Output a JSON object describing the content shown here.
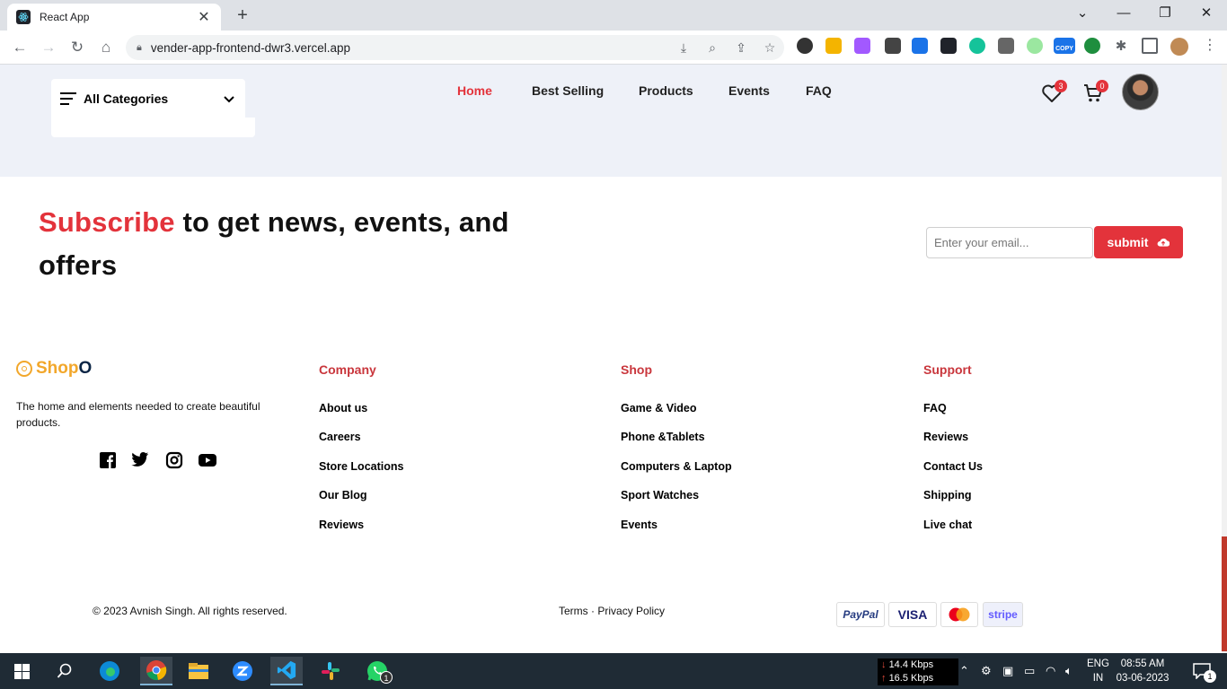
{
  "browser": {
    "tab_title": "React App",
    "url": "vender-app-frontend-dwr3.vercel.app",
    "extension_badge_copy": "COPY"
  },
  "header": {
    "categories_label": "All Categories",
    "nav": [
      "Home",
      "Best Selling",
      "Products",
      "Events",
      "FAQ"
    ],
    "wishlist_count": "3",
    "cart_count": "0"
  },
  "subscribe": {
    "highlight": "Subscribe",
    "rest": " to get news, events, and offers",
    "placeholder": "Enter your email...",
    "submit_label": "submit"
  },
  "footer": {
    "logo_part1": "Shop",
    "logo_part2": "O",
    "tagline": "The home and elements needed to create beautiful products.",
    "columns": [
      {
        "title": "Company",
        "links": [
          "About us",
          "Careers",
          "Store Locations",
          "Our Blog",
          "Reviews"
        ]
      },
      {
        "title": "Shop",
        "links": [
          "Game & Video",
          "Phone &Tablets",
          "Computers & Laptop",
          "Sport Watches",
          "Events"
        ]
      },
      {
        "title": "Support",
        "links": [
          "FAQ",
          "Reviews",
          "Contact Us",
          "Shipping",
          "Live chat"
        ]
      }
    ],
    "copyright": "© 2023 Avnish Singh. All rights reserved.",
    "terms": "Terms",
    "separator": "·",
    "privacy": "Privacy Policy",
    "payments": [
      "PayPal",
      "VISA",
      "stripe"
    ]
  },
  "taskbar": {
    "net_down": "14.4 Kbps",
    "net_up": "16.5 Kbps",
    "lang1": "ENG",
    "lang2": "IN",
    "time": "08:55 AM",
    "date": "03-06-2023",
    "whatsapp_badge": "1",
    "notifications_badge": "1"
  },
  "colors": {
    "accent_red": "#e3333b",
    "logo_orange": "#f2a72b",
    "header_band": "#eef1f8"
  }
}
